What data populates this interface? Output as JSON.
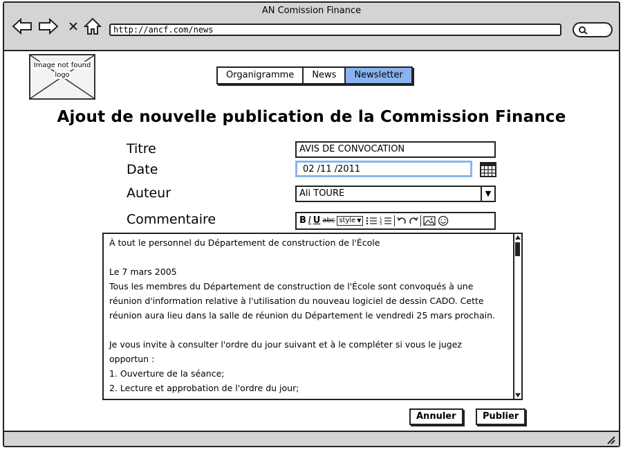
{
  "window": {
    "title": "AN Comission Finance"
  },
  "browser": {
    "url": "http://ancf.com/news"
  },
  "logo": {
    "alt_line1": "Image not found",
    "alt_line2": "logo"
  },
  "nav": {
    "tabs": [
      {
        "label": "Organigramme",
        "active": false
      },
      {
        "label": "News",
        "active": false
      },
      {
        "label": "Newsletter",
        "active": true
      }
    ]
  },
  "page": {
    "heading": "Ajout de nouvelle publication de la Commission Finance"
  },
  "form": {
    "titre": {
      "label": "Titre",
      "value": "AVIS DE CONVOCATION"
    },
    "date": {
      "label": "Date",
      "value": "02 /11 /2011"
    },
    "auteur": {
      "label": "Auteur",
      "value": "Ali TOURE"
    },
    "commentaire": {
      "label": "Commentaire",
      "toolbar": {
        "bold": "B",
        "italic": "I",
        "underline": "U",
        "strike": "abc",
        "style": "style"
      },
      "lines": [
        "À tout le personnel du Département de construction de l'École",
        "",
        "Le 7 mars 2005",
        "Tous les membres du Département de construction de l'École sont convoqués à une",
        "réunion d'information relative à l'utilisation du nouveau logiciel de dessin CADO. Cette",
        "réunion aura lieu dans la salle de réunion du Département le vendredi 25 mars prochain.",
        "",
        "Je vous invite à consulter l'ordre du jour suivant et à le compléter si vous le jugez",
        "opportun :",
        "1. Ouverture de la séance;",
        "2. Lecture et approbation de l'ordre du jour;"
      ]
    }
  },
  "actions": {
    "cancel": "Annuler",
    "publish": "Publier"
  },
  "colors": {
    "accent": "#8ab4f0",
    "chrome": "#d4d4d4"
  }
}
